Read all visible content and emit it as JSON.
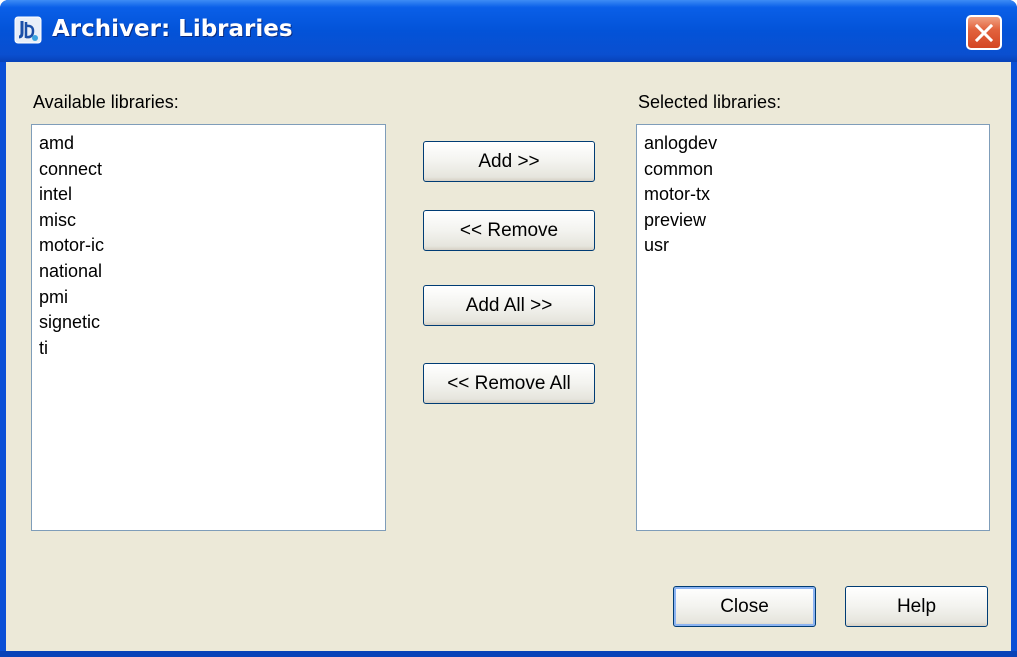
{
  "window": {
    "title": "Archiver: Libraries",
    "icon": "archiver-app-icon",
    "close_icon": "close-x-icon"
  },
  "available": {
    "label": "Available libraries:",
    "items": [
      "amd",
      "connect",
      "intel",
      "misc",
      "motor-ic",
      "national",
      "pmi",
      "signetic",
      "ti"
    ]
  },
  "selected": {
    "label": "Selected libraries:",
    "items": [
      "anlogdev",
      "common",
      "motor-tx",
      "preview",
      "usr"
    ]
  },
  "buttons": {
    "add": "Add >>",
    "remove": "<< Remove",
    "add_all": "Add All >>",
    "remove_all": "<< Remove All",
    "close": "Close",
    "help": "Help"
  },
  "colors": {
    "titlebar": "#0353d8",
    "client_bg": "#ece9d8",
    "close_button": "#d44623",
    "listbox_border": "#7f9db9"
  }
}
